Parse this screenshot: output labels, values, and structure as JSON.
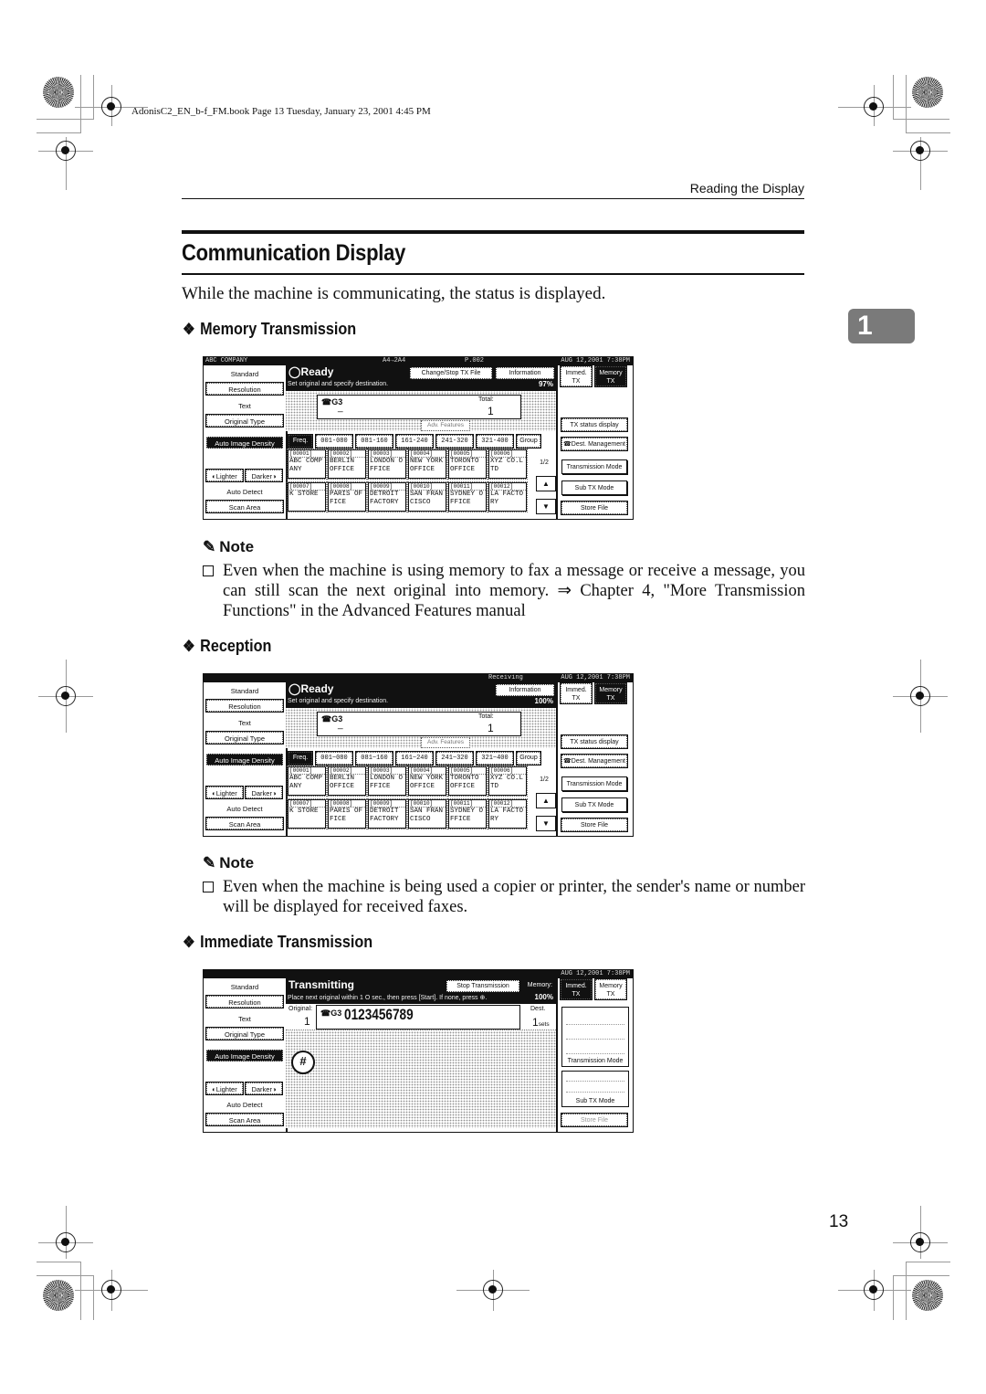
{
  "file_info": "AdonisC2_EN_b-f_FM.book  Page 13  Tuesday, January 23, 2001  4:45 PM",
  "running_head": "Reading the Display",
  "chapter_tab": "1",
  "page_title": "Communication Display",
  "intro": "While the machine is communicating, the status is displayed.",
  "page_number": "13",
  "sections": [
    {
      "heading": "Memory Transmission",
      "screen": {
        "top_bar": {
          "left": "ABC COMPANY",
          "paper": "A4→2A4",
          "page": "P.002",
          "datetime": "AUG  12,2001  7:38PM"
        },
        "status_title": "Ready",
        "status_msg": "Set original and specify destination.",
        "memory_pct": "97%",
        "header_buttons": [
          "Change/Stop TX File",
          "Information"
        ],
        "modes": [
          "Immed. TX",
          "Memory TX"
        ],
        "active_mode": "Memory TX",
        "dest_label": "G3",
        "total_label": "Total:",
        "total_value": "1",
        "adv_features": "Adv. Features",
        "left_menu": {
          "standard": "Standard",
          "resolution": "Resolution",
          "text": "Text",
          "original_type": "Original Type",
          "auto_density": "Auto Image Density",
          "lighter": "Lighter",
          "darker": "Darker",
          "auto_detect": "Auto Detect",
          "scan_area": "Scan Area"
        },
        "tabs": [
          "Freq.",
          "001-080",
          "081-160",
          "161-240",
          "241-320",
          "321-400",
          "Group"
        ],
        "destinations": [
          {
            "id": "[00001]",
            "name": "ABC COMP ANY"
          },
          {
            "id": "[00002]",
            "name": "BERLIN OFFICE"
          },
          {
            "id": "[00003]",
            "name": "LONDON O FFICE"
          },
          {
            "id": "[00004]",
            "name": "NEW YORK OFFICE"
          },
          {
            "id": "[00005]",
            "name": "TORONTO OFFICE"
          },
          {
            "id": "[00006]",
            "name": "XYZ CO.L TD"
          },
          {
            "id": "[00007]",
            "name": "K STORE"
          },
          {
            "id": "[00008]",
            "name": "PARIS OF FICE"
          },
          {
            "id": "[00009]",
            "name": "DETROIT FACTORY"
          },
          {
            "id": "[00010]",
            "name": "SAN FRAN CISCO"
          },
          {
            "id": "[00011]",
            "name": "SYDNEY O FFICE"
          },
          {
            "id": "[00012]",
            "name": "LA FACTO RY"
          }
        ],
        "pager": "1/2",
        "right_buttons": {
          "tx_status": "TX status display",
          "dest_mgmt": "Dest. Management",
          "tx_mode": "Transmission Mode",
          "sub_tx": "Sub TX Mode",
          "store_file": "Store File"
        }
      },
      "note": "Even when the machine is using memory to fax a message or receive a message, you can still scan the next original into memory. ⇒ Chapter 4, \"More Transmission Functions\" in the Advanced Features manual"
    },
    {
      "heading": "Reception",
      "screen": {
        "top_bar": {
          "status": "Receiving",
          "datetime": "AUG  12,2001  7:38PM"
        },
        "status_title": "Ready",
        "status_msg": "Set original and specify destination.",
        "memory_pct": "100%",
        "header_buttons": [
          "Information"
        ],
        "modes": [
          "Immed. TX",
          "Memory TX"
        ],
        "dest_label": "G3",
        "total_label": "Total:",
        "total_value": "1",
        "adv_features": "Adv. Features",
        "tabs": [
          "Freq.",
          "001~080",
          "081~160",
          "161~240",
          "241~320",
          "321~400",
          "Group"
        ]
      },
      "note": "Even when the machine is being used a copier or printer, the sender's name or number will be displayed for received faxes."
    },
    {
      "heading": "Immediate Transmission",
      "screen": {
        "top_bar": {
          "datetime": "AUG  12,2001  7:38PM"
        },
        "status_title": "Transmitting",
        "status_msg": "Place next original within  1 O sec., then press [Start]. If none, press ⊕.",
        "stop_button": "Stop Transmission",
        "memory_label": "Memory:",
        "memory_pct": "100%",
        "modes": [
          "Immed. TX",
          "Memory TX"
        ],
        "active_mode": "Immed. TX",
        "original_label": "Original:",
        "original_value": "1",
        "dest_label": "G3",
        "number": "0123456789",
        "dest_count_label": "Dest.",
        "dest_count": "1",
        "dest_count_unit": "sets",
        "hash_key": "#",
        "right_buttons": {
          "tx_mode": "Transmission Mode",
          "sub_tx": "Sub TX Mode",
          "store_file": "Store File"
        }
      }
    }
  ],
  "note_label": "Note"
}
